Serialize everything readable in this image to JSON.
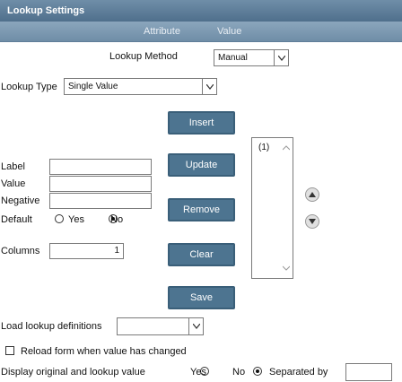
{
  "window": {
    "title": "Lookup Settings"
  },
  "header": {
    "col_attribute": "Attribute",
    "col_value": "Value"
  },
  "lookup_method": {
    "label": "Lookup Method",
    "value": "Manual"
  },
  "lookup_type": {
    "label": "Lookup Type",
    "value": "Single Value"
  },
  "fields": {
    "label_label": "Label",
    "value_label": "Value",
    "negative_label": "Negative",
    "default_label": "Default",
    "default_yes": "Yes",
    "default_no": "No",
    "columns_label": "Columns",
    "columns_value": "1"
  },
  "buttons": {
    "insert": "Insert",
    "update": "Update",
    "remove": "Remove",
    "clear": "Clear",
    "save": "Save"
  },
  "list": {
    "items": [
      "(1)"
    ]
  },
  "load_defs": {
    "label": "Load lookup definitions",
    "value": ""
  },
  "reload": {
    "label": "Reload form when value has changed",
    "checked": false
  },
  "display_original": {
    "label": "Display original and lookup value",
    "yes": "Yes",
    "no": "No",
    "separated_by_label": "Separated by",
    "separated_by_value": ""
  }
}
